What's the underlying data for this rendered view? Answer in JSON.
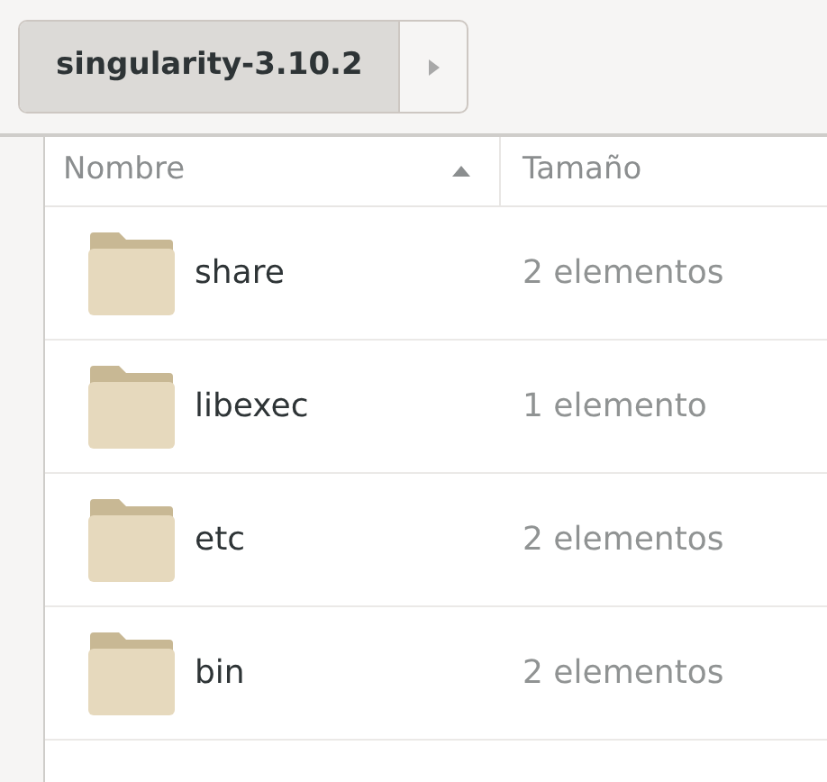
{
  "path_bar": {
    "segments": [
      {
        "label": "singularity-3.10.2",
        "selected": true
      }
    ]
  },
  "columns": [
    {
      "label": "Nombre",
      "sorted": true
    },
    {
      "label": "Tamaño",
      "sorted": false
    }
  ],
  "rows": [
    {
      "name": "share",
      "size": "2 elementos"
    },
    {
      "name": "libexec",
      "size": "1 elemento"
    },
    {
      "name": "etc",
      "size": "2 elementos"
    },
    {
      "name": "bin",
      "size": "2 elementos"
    }
  ]
}
